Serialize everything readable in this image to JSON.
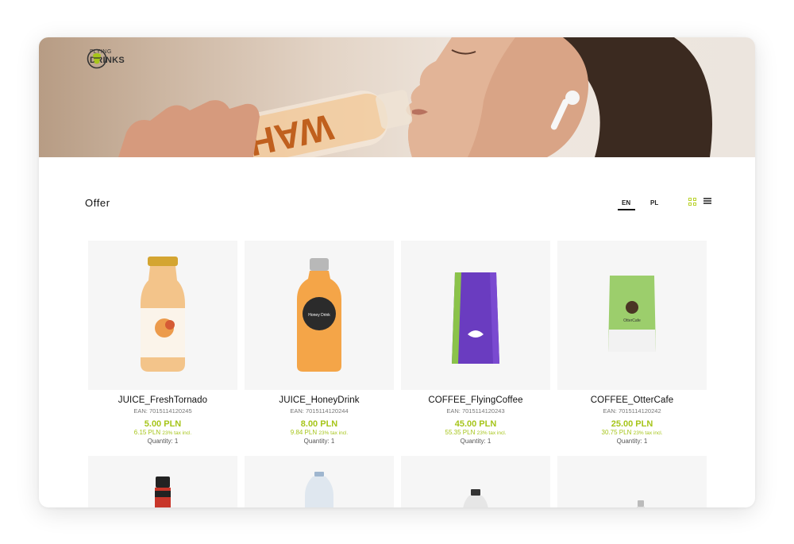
{
  "brand": {
    "line1": "FLYING",
    "line2": "DRINKS",
    "bottle_text": "WAH"
  },
  "page": {
    "title": "Offer"
  },
  "languages": [
    {
      "code": "EN",
      "active": true
    },
    {
      "code": "PL",
      "active": false
    }
  ],
  "views": [
    {
      "name": "grid-view",
      "active": true
    },
    {
      "name": "list-view",
      "active": false
    }
  ],
  "colors": {
    "accent": "#a6c51a",
    "text": "#111111"
  },
  "products": [
    {
      "name": "JUICE_FreshTornado",
      "ean": "EAN: 7015114120245",
      "price": "5.00 PLN",
      "gross": "6.15 PLN",
      "tax": "23% tax incl.",
      "qty": "Quantity: 1"
    },
    {
      "name": "JUICE_HoneyDrink",
      "ean": "EAN: 7015114120244",
      "price": "8.00 PLN",
      "gross": "9.84 PLN",
      "tax": "23% tax incl.",
      "qty": "Quantity: 1"
    },
    {
      "name": "COFFEE_FlyingCoffee",
      "ean": "EAN: 7015114120243",
      "price": "45.00 PLN",
      "gross": "55.35 PLN",
      "tax": "23% tax incl.",
      "qty": "Quantity: 1"
    },
    {
      "name": "COFFEE_OtterCafe",
      "ean": "EAN: 7015114120242",
      "price": "25.00 PLN",
      "gross": "30.75 PLN",
      "tax": "23% tax incl.",
      "qty": "Quantity: 1"
    }
  ],
  "product_labels": {
    "honey_drink": "Honey Drink",
    "otter_cafe": "OtterCafe"
  }
}
